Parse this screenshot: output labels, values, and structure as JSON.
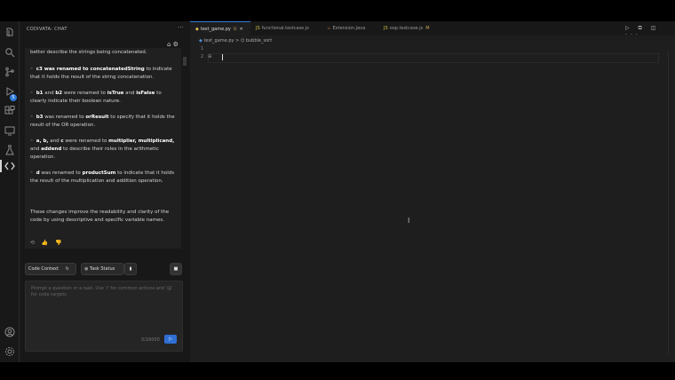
{
  "sidebar": {
    "title": "CODIVATA: CHAT",
    "more": "···",
    "header_icons": "⌂ ⚙"
  },
  "chat": {
    "line0": "better describe the strings being concatenated.",
    "item1_pre": "c3 was renamed to ",
    "item1_bold": "concatenatedString",
    "item1_post": " to indicate that it holds the result of the string concatenation.",
    "item2_a": "b1",
    "item2_b": " and ",
    "item2_c": "b2",
    "item2_d": " were renamed to ",
    "item2_e": "isTrue",
    "item2_f": " and ",
    "item2_g": "isFalse",
    "item2_h": " to clearly indicate their boolean nature.",
    "item3_a": "b3",
    "item3_b": " was renamed to ",
    "item3_c": "orResult",
    "item3_d": " to specify that it holds the result of the OR operation.",
    "item4_a": "a, b,",
    "item4_b": " and ",
    "item4_c": "c",
    "item4_d": " were renamed to ",
    "item4_e": "multiplier, multiplicand,",
    "item4_f": " and ",
    "item4_g": "addend",
    "item4_h": " to describe their roles in the arithmetic operation.",
    "item5_a": "d",
    "item5_b": " was renamed to ",
    "item5_c": "productSum",
    "item5_d": " to indicate that it holds the result of the multiplication and addition operation.",
    "summary": "These changes improve the readability and clarity of the code by using descriptive and specific variable names.",
    "feedback": "⟲ 👍 👎"
  },
  "context_bar": {
    "code_context": "Code Context",
    "task_status": "Task Status"
  },
  "input": {
    "placeholder": "Prompt a question or a task. Use '/' for common actions and '@' for code targets",
    "count": "0/16000",
    "send": "▷"
  },
  "tabs": [
    {
      "icon": "◆",
      "label": "test_game.py",
      "mod": "U",
      "close": "✕"
    },
    {
      "icon": "JS",
      "label": "functional.testcase.js"
    },
    {
      "icon": "☕",
      "label": "Extension.Java"
    },
    {
      "icon": "JS",
      "label": "oop.testcase.js",
      "mod": "M"
    }
  ],
  "editor_actions": "▷ ⧉ ◫ ···",
  "breadcrumb": {
    "file": "test_game.py",
    "sep": ">",
    "symbol": "bubble_sort"
  },
  "lines": [
    "1",
    "2"
  ],
  "line2_fold": "⊞"
}
